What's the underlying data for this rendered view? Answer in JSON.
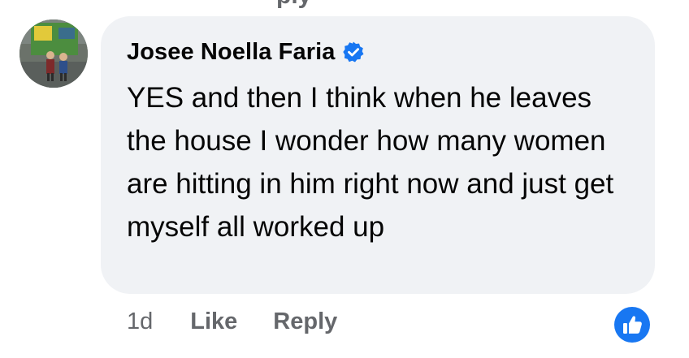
{
  "comment": {
    "author": "Josee Noella Faria",
    "verified": true,
    "text": "YES and then I think when he leaves the house I wonder how many women are hitting in him right now and just get myself all worked up",
    "time": "1d",
    "like_label": "Like",
    "reply_label": "Reply",
    "reaction": "like-reaction-icon"
  },
  "colors": {
    "bubble": "#f0f2f5",
    "text": "#050505",
    "secondary": "#65676b",
    "accent": "#1877f2"
  }
}
